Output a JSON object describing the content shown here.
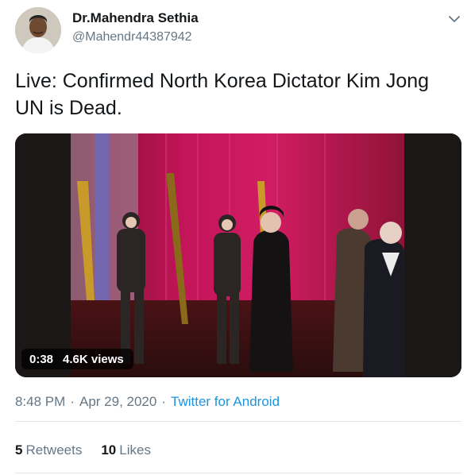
{
  "author": {
    "name": "Dr.Mahendra Sethia",
    "handle": "@Mahendr44387942"
  },
  "tweet": {
    "text": "Live: Confirmed North Korea Dictator Kim Jong UN is Dead."
  },
  "video": {
    "duration": "0:38",
    "views": "4.6K views"
  },
  "meta": {
    "time": "8:48 PM",
    "separator": "·",
    "date": "Apr 29, 2020",
    "source": "Twitter for Android"
  },
  "stats": {
    "retweets_count": "5",
    "retweets_label": "Retweets",
    "likes_count": "10",
    "likes_label": "Likes"
  },
  "icons": {
    "more": "chevron-down-icon"
  },
  "colors": {
    "link": "#1b95e0",
    "secondary_text": "#657786",
    "primary_text": "#14171a",
    "stage_curtain": "#b0104a"
  }
}
